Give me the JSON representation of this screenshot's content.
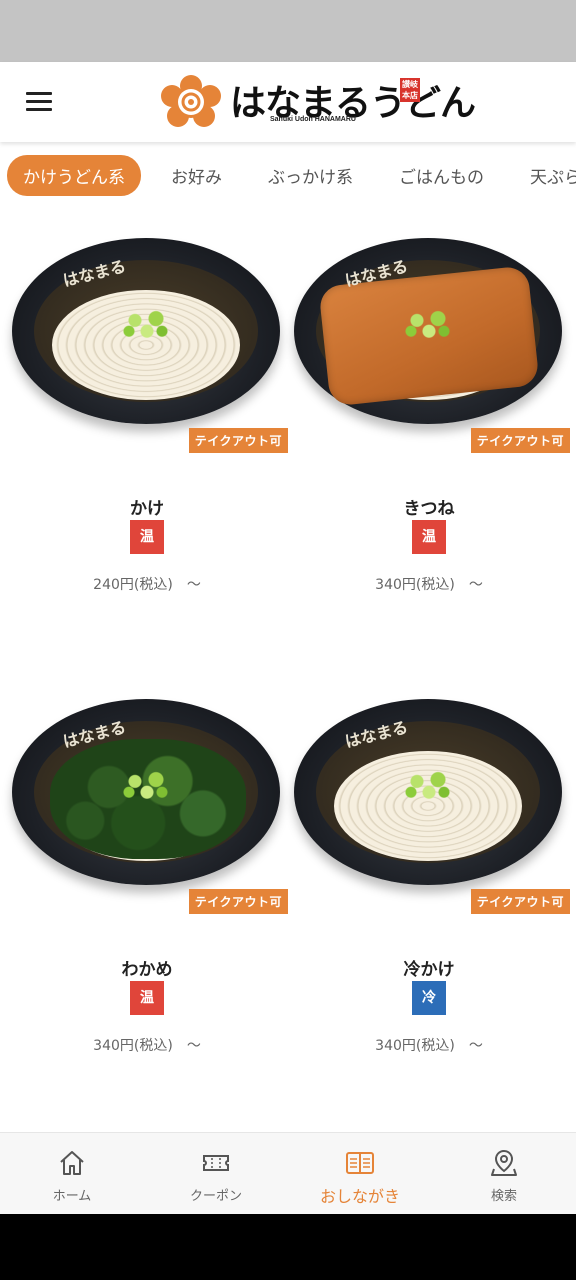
{
  "header": {
    "logo_text": "はなまるうどん",
    "logo_sub": "Sanuki Udon HANAMARU",
    "logo_seal": "讃岐本店"
  },
  "categories": [
    {
      "label": "かけうどん系",
      "active": true
    },
    {
      "label": "お好み",
      "active": false
    },
    {
      "label": "ぶっかけ系",
      "active": false
    },
    {
      "label": "ごはんもの",
      "active": false
    },
    {
      "label": "天ぷら",
      "active": false
    }
  ],
  "menu_items": [
    {
      "name": "かけ",
      "temp": "温",
      "temp_type": "hot",
      "price": "240円(税込)　〜",
      "badge": "テイクアウト可",
      "topping": "plain"
    },
    {
      "name": "きつね",
      "temp": "温",
      "temp_type": "hot",
      "price": "340円(税込)　〜",
      "badge": "テイクアウト可",
      "topping": "tofu"
    },
    {
      "name": "わかめ",
      "temp": "温",
      "temp_type": "hot",
      "price": "340円(税込)　〜",
      "badge": "テイクアウト可",
      "topping": "wakame"
    },
    {
      "name": "冷かけ",
      "temp": "冷",
      "temp_type": "cold",
      "price": "340円(税込)　〜",
      "badge": "テイクアウト可",
      "topping": "plain"
    }
  ],
  "bowl_brand": "はなまる",
  "bottom_nav": [
    {
      "label": "ホーム",
      "icon": "home-icon",
      "active": false
    },
    {
      "label": "クーポン",
      "icon": "ticket-icon",
      "active": false
    },
    {
      "label": "おしながき",
      "icon": "menu-book-icon",
      "active": true
    },
    {
      "label": "検索",
      "icon": "map-pin-icon",
      "active": false
    }
  ],
  "colors": {
    "accent": "#e58438",
    "hot": "#e0453a",
    "cold": "#2c6db8"
  }
}
